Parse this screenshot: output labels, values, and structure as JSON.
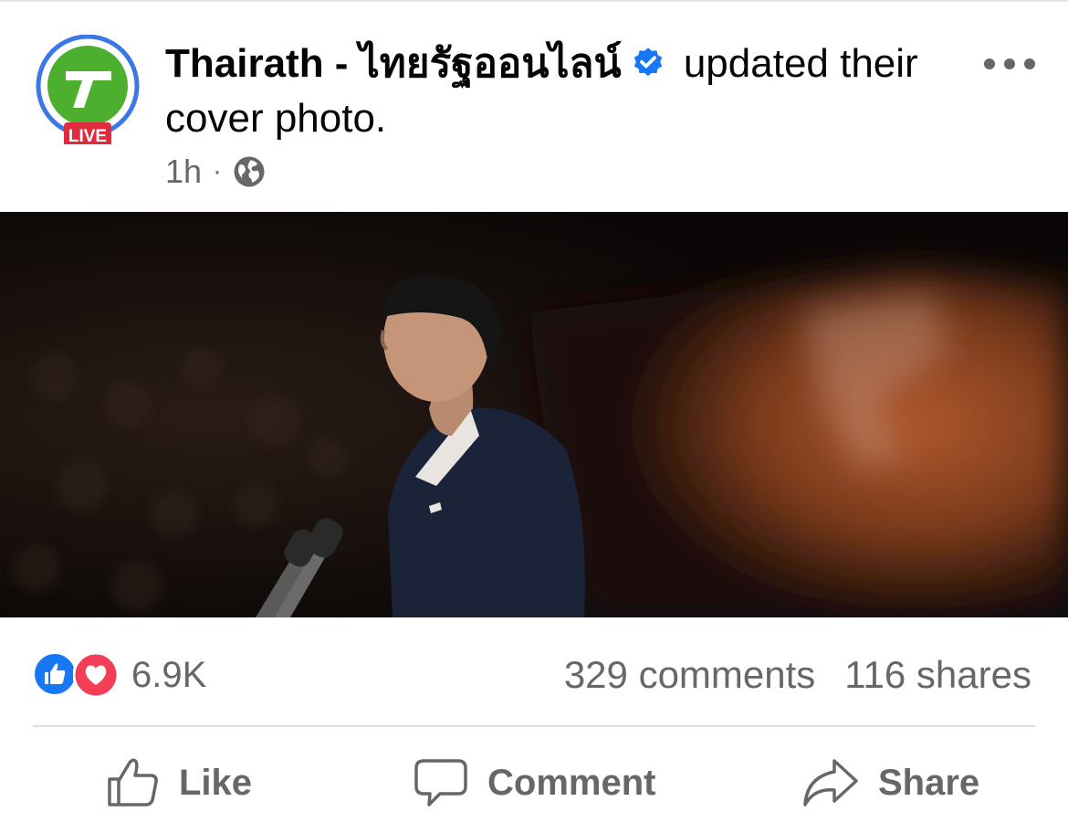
{
  "post": {
    "author_name": "Thairath - ไทยรัฐออนไลน์",
    "action_text": " updated their cover photo.",
    "avatar_badge": "LIVE",
    "time": "1h",
    "separator": "·",
    "privacy_icon": "globe-icon",
    "verified_icon": "verified-badge-icon",
    "more_icon": "more-options-icon"
  },
  "stats": {
    "reactions_count": "6.9K",
    "reaction_icons": [
      "like-reaction-icon",
      "love-reaction-icon"
    ],
    "comments": "329 comments",
    "shares": "116 shares"
  },
  "actions": {
    "like": "Like",
    "comment": "Comment",
    "share": "Share"
  },
  "colors": {
    "brand_green": "#4caf2e",
    "live_red": "#e02b3c",
    "like_blue": "#1877f2",
    "love_red": "#f33e58",
    "secondary_text": "#65676b"
  }
}
